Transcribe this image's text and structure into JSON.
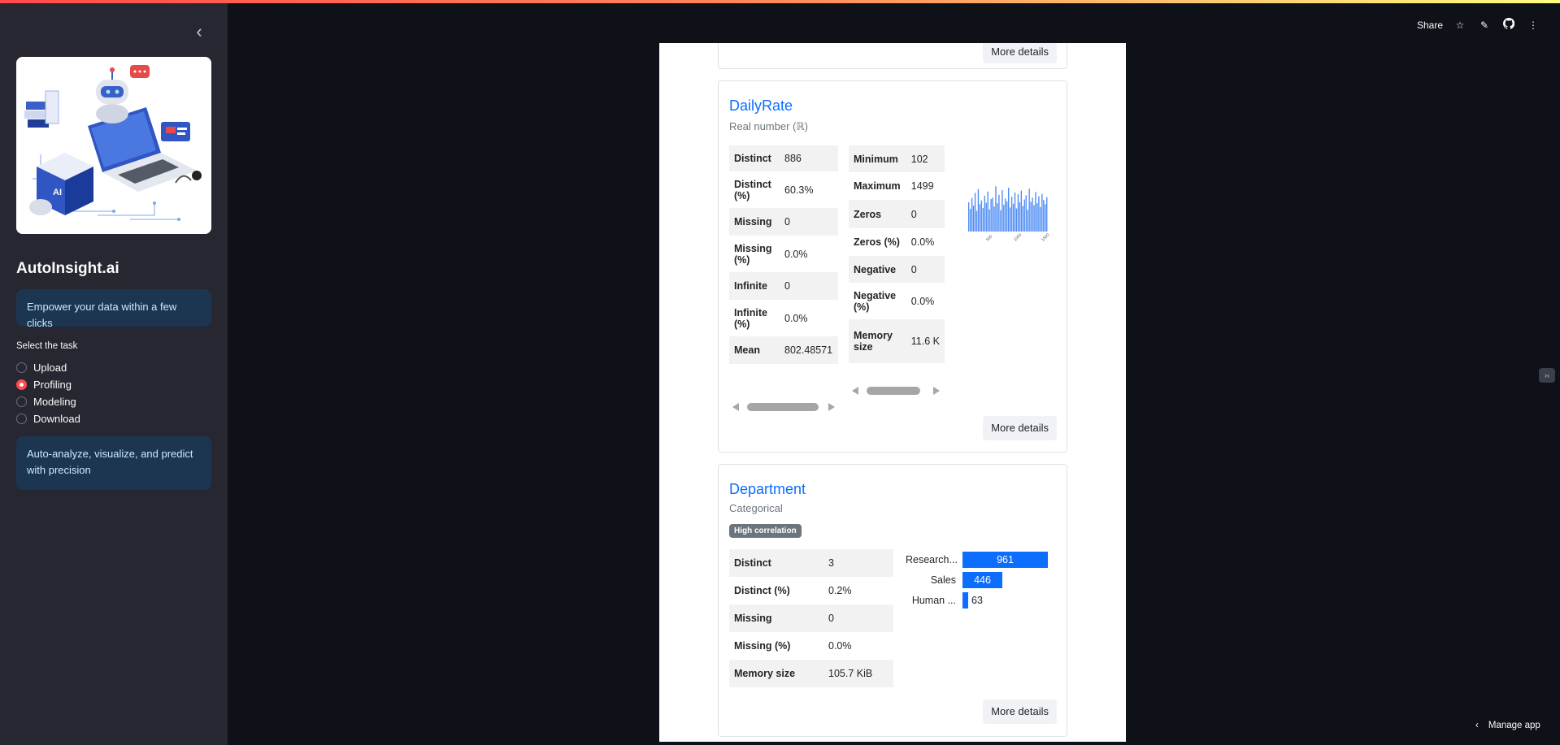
{
  "sidebar": {
    "app_title": "AutoInsight.ai",
    "info_top": "Empower your data within a few clicks",
    "radio_label": "Select the task",
    "radio_options": [
      "Upload",
      "Profiling",
      "Modeling",
      "Download"
    ],
    "radio_selected": "Profiling",
    "info_bottom": "Auto-analyze, visualize, and predict with precision",
    "hero_icon_badge": "AI"
  },
  "header": {
    "share_label": "Share",
    "manage_app_label": "Manage app"
  },
  "report": {
    "top_card": {
      "more_details": "More details"
    },
    "daily_rate": {
      "name": "DailyRate",
      "type": "Real number (ℝ)",
      "left_stats": [
        {
          "k": "Distinct",
          "v": "886"
        },
        {
          "k": "Distinct (%)",
          "v": "60.3%"
        },
        {
          "k": "Missing",
          "v": "0"
        },
        {
          "k": "Missing (%)",
          "v": "0.0%"
        },
        {
          "k": "Infinite",
          "v": "0"
        },
        {
          "k": "Infinite (%)",
          "v": "0.0%"
        },
        {
          "k": "Mean",
          "v": "802.48571"
        }
      ],
      "right_stats": [
        {
          "k": "Minimum",
          "v": "102"
        },
        {
          "k": "Maximum",
          "v": "1499"
        },
        {
          "k": "Zeros",
          "v": "0"
        },
        {
          "k": "Zeros (%)",
          "v": "0.0%"
        },
        {
          "k": "Negative",
          "v": "0"
        },
        {
          "k": "Negative (%)",
          "v": "0.0%"
        },
        {
          "k": "Memory size",
          "v": "11.6 K"
        }
      ],
      "more_details": "More details",
      "accent_color": "#4c8bf5"
    },
    "department": {
      "name": "Department",
      "type": "Categorical",
      "badge": "High correlation",
      "stats": [
        {
          "k": "Distinct",
          "v": "3"
        },
        {
          "k": "Distinct (%)",
          "v": "0.2%"
        },
        {
          "k": "Missing",
          "v": "0"
        },
        {
          "k": "Missing (%)",
          "v": "0.0%"
        },
        {
          "k": "Memory size",
          "v": "105.7 KiB"
        }
      ],
      "more_details": "More details"
    }
  },
  "chart_data": [
    {
      "type": "bar",
      "title": "",
      "xlabel": "",
      "ylabel": "",
      "x_tick_labels": [
        "500",
        "1000",
        "1500"
      ],
      "values": [
        0.62,
        0.48,
        0.71,
        0.55,
        0.82,
        0.44,
        0.9,
        0.58,
        0.66,
        0.5,
        0.76,
        0.61,
        0.85,
        0.47,
        0.69,
        0.72,
        0.53,
        0.96,
        0.6,
        0.78,
        0.45,
        0.88,
        0.57,
        0.7,
        0.64,
        0.93,
        0.51,
        0.74,
        0.59,
        0.83,
        0.49,
        0.79,
        0.62,
        0.87,
        0.54,
        0.68,
        0.77,
        0.46,
        0.91,
        0.63,
        0.72,
        0.56,
        0.84,
        0.6,
        0.75,
        0.52,
        0.8,
        0.67,
        0.58,
        0.73
      ],
      "color": "#4c8bf5"
    },
    {
      "type": "bar",
      "orientation": "horizontal",
      "categories": [
        "Research...",
        "Sales",
        "Human ..."
      ],
      "values": [
        961,
        446,
        63
      ],
      "color": "#0d6efd"
    }
  ]
}
